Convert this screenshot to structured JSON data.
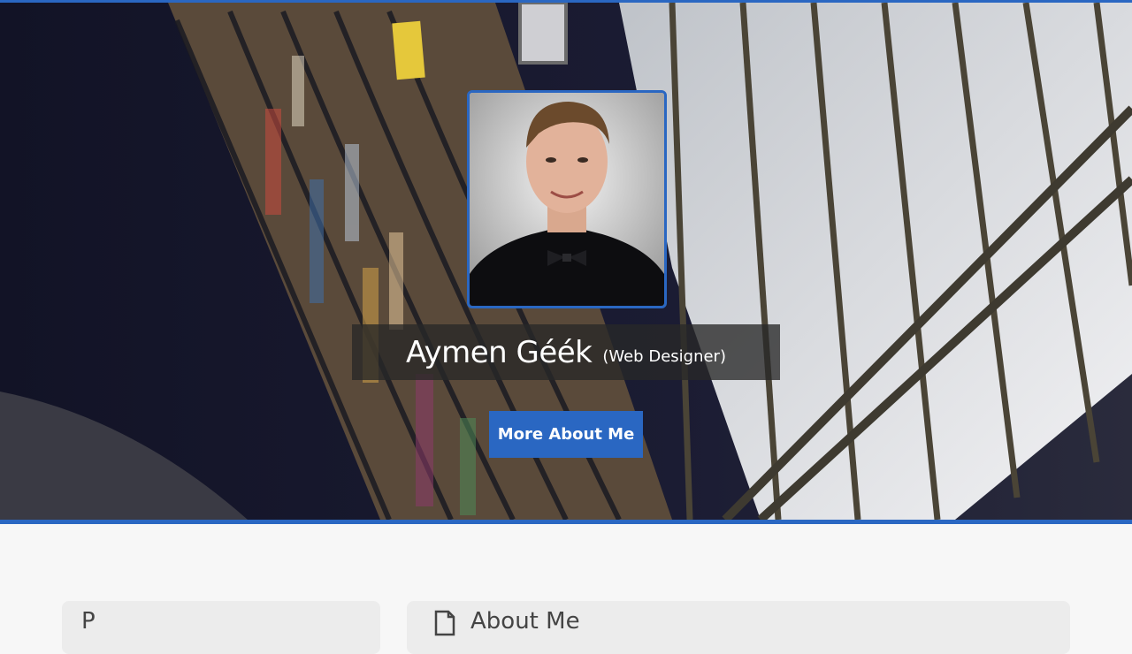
{
  "hero": {
    "name": "Aymen Géék",
    "role": "(Web Designer)",
    "cta_label": "More About Me"
  },
  "sections": {
    "left_title": "P",
    "right_title": "About Me"
  },
  "colors": {
    "accent": "#2a67c2",
    "name_band": "#282828",
    "page_bg": "#f7f7f7"
  },
  "icons": {
    "about": "document-icon"
  }
}
